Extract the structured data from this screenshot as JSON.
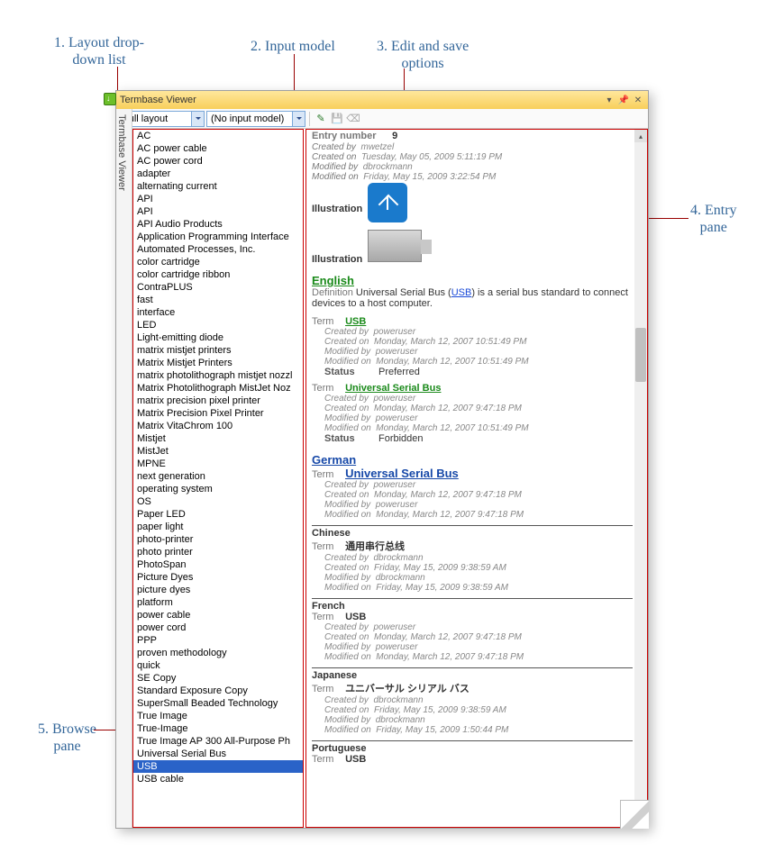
{
  "callouts": {
    "c1": "1. Layout drop-\ndown list",
    "c2": "2. Input model",
    "c3": "3. Edit and save\noptions",
    "c4": "4. Entry\npane",
    "c5": "5. Browse\npane"
  },
  "window": {
    "title": "Termbase Viewer",
    "vertical_tab": "Termbase Viewer"
  },
  "toolbar": {
    "layout_value": "Full layout",
    "input_model_value": "(No input model)"
  },
  "browse_items": [
    "AC",
    "AC power cable",
    "AC power cord",
    "adapter",
    "alternating current",
    "API",
    "API",
    "API Audio Products",
    "Application Programming Interface",
    "Automated Processes, Inc.",
    "color cartridge",
    "color cartridge ribbon",
    "ContraPLUS",
    "fast",
    "interface",
    "LED",
    "Light-emitting diode",
    "matrix mistjet printers",
    "Matrix Mistjet Printers",
    "matrix photolithograph mistjet nozzl",
    "Matrix Photolithograph MistJet Noz",
    "matrix precision pixel printer",
    "Matrix Precision Pixel Printer",
    "Matrix VitaChrom 100",
    "Mistjet",
    "MistJet",
    "MPNE",
    "next generation",
    "operating system",
    "OS",
    "Paper LED",
    "paper light",
    "photo-printer",
    "photo printer",
    "PhotoSpan",
    "Picture Dyes",
    "picture dyes",
    "platform",
    "power cable",
    "power cord",
    "PPP",
    "proven methodology",
    "quick",
    "SE Copy",
    "Standard Exposure Copy",
    "SuperSmall Beaded Technology",
    "True Image",
    "True-Image",
    "True Image AP 300 All-Purpose Ph",
    "Universal Serial Bus",
    "USB",
    "USB cable"
  ],
  "browse_selected": "USB",
  "entry": {
    "number_label": "Entry number",
    "number": "9",
    "created_by": "mwetzel",
    "created_on": "Tuesday, May 05, 2009 5:11:19 PM",
    "modified_by": "dbrockmann",
    "modified_on": "Friday, May 15, 2009 3:22:54 PM",
    "illus_label": "Illustration",
    "english": {
      "lang": "English",
      "def_label": "Definition",
      "def_pre": "Universal Serial Bus (",
      "def_link": "USB",
      "def_post": ") is a serial bus standard to connect devices to a host computer.",
      "term1": {
        "label": "Term",
        "text": "USB",
        "cb": "poweruser",
        "co": "Monday, March 12, 2007 10:51:49 PM",
        "mb": "poweruser",
        "mo": "Monday, March 12, 2007 10:51:49 PM",
        "status_label": "Status",
        "status": "Preferred"
      },
      "term2": {
        "label": "Term",
        "text": "Universal Serial Bus",
        "cb": "poweruser",
        "co": "Monday, March 12, 2007 9:47:18 PM",
        "mb": "poweruser",
        "mo": "Monday, March 12, 2007 10:51:49 PM",
        "status_label": "Status",
        "status": "Forbidden"
      }
    },
    "german": {
      "lang": "German",
      "term": {
        "label": "Term",
        "text": "Universal Serial Bus",
        "cb": "poweruser",
        "co": "Monday, March 12, 2007 9:47:18 PM",
        "mb": "poweruser",
        "mo": "Monday, March 12, 2007 9:47:18 PM"
      }
    },
    "chinese": {
      "lang": "Chinese",
      "term": {
        "label": "Term",
        "text": "通用串行总线",
        "cb": "dbrockmann",
        "co": "Friday, May 15, 2009 9:38:59 AM",
        "mb": "dbrockmann",
        "mo": "Friday, May 15, 2009 9:38:59 AM"
      }
    },
    "french": {
      "lang": "French",
      "term": {
        "label": "Term",
        "text": "USB",
        "cb": "poweruser",
        "co": "Monday, March 12, 2007 9:47:18 PM",
        "mb": "poweruser",
        "mo": "Monday, March 12, 2007 9:47:18 PM"
      }
    },
    "japanese": {
      "lang": "Japanese",
      "term": {
        "label": "Term",
        "text": "ユニバーサル シリアル バス",
        "cb": "dbrockmann",
        "co": "Friday, May 15, 2009 9:38:59 AM",
        "mb": "dbrockmann",
        "mo": "Friday, May 15, 2009 1:50:44 PM"
      }
    },
    "portuguese": {
      "lang": "Portuguese",
      "term": {
        "label": "Term",
        "text": "USB"
      }
    }
  },
  "meta_labels": {
    "cb": "Created by",
    "co": "Created on",
    "mb": "Modified by",
    "mo": "Modified on"
  }
}
